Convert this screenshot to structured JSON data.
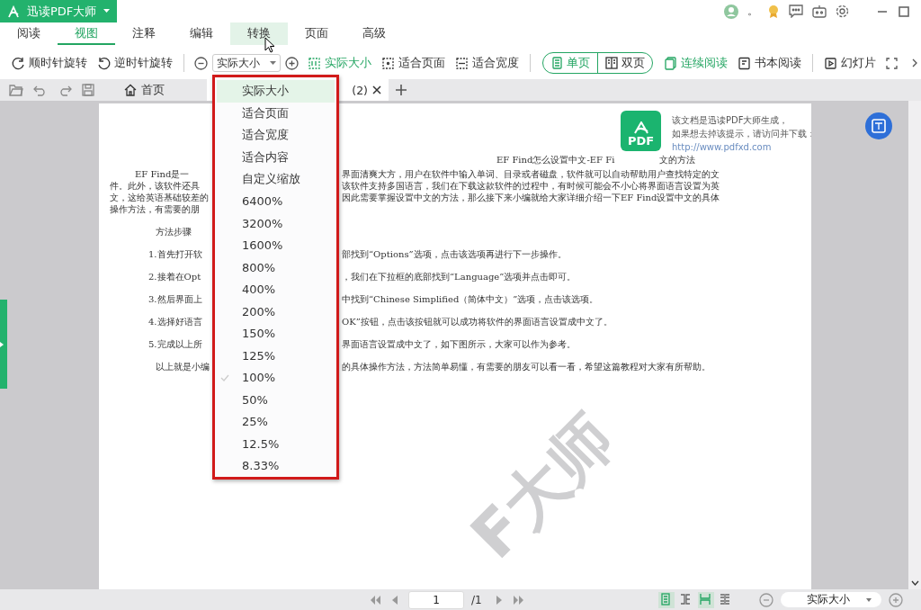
{
  "app": {
    "title": "迅读PDF大师",
    "status_mark": "。"
  },
  "menu_tabs": [
    {
      "label": "阅读",
      "selected": false,
      "hovered": false
    },
    {
      "label": "视图",
      "selected": true,
      "hovered": false
    },
    {
      "label": "注释",
      "selected": false,
      "hovered": false
    },
    {
      "label": "编辑",
      "selected": false,
      "hovered": false
    },
    {
      "label": "转换",
      "selected": false,
      "hovered": true
    },
    {
      "label": "页面",
      "selected": false,
      "hovered": false
    },
    {
      "label": "高级",
      "selected": false,
      "hovered": false
    }
  ],
  "toolbar": [
    {
      "kind": "button",
      "label": "顺时针旋转",
      "active": false
    },
    {
      "kind": "button",
      "label": "逆时针旋转",
      "active": false
    },
    {
      "kind": "divider"
    },
    {
      "kind": "icon"
    },
    {
      "kind": "combo",
      "value": "实际大小"
    },
    {
      "kind": "icon"
    },
    {
      "kind": "button",
      "label": "实际大小",
      "active": true
    },
    {
      "kind": "button",
      "label": "适合页面",
      "active": false
    },
    {
      "kind": "button",
      "label": "适合宽度",
      "active": false
    },
    {
      "kind": "divider"
    },
    {
      "kind": "segment",
      "options": [
        {
          "label": "单页",
          "selected": true
        },
        {
          "label": "双页",
          "selected": false
        }
      ]
    },
    {
      "kind": "button",
      "label": "连续阅读",
      "active": true
    },
    {
      "kind": "button",
      "label": "书本阅读",
      "active": false
    },
    {
      "kind": "divider"
    },
    {
      "kind": "button",
      "label": "幻灯片",
      "active": false
    },
    {
      "kind": "icon"
    },
    {
      "kind": "more"
    }
  ],
  "doc_tabs": [
    {
      "label": "首页",
      "selected": false
    },
    {
      "label": "(2)",
      "selected": true
    }
  ],
  "zoom_menu": [
    {
      "label": "实际大小",
      "selected": true,
      "checked": false
    },
    {
      "label": "适合页面",
      "selected": false,
      "checked": false
    },
    {
      "label": "适合宽度",
      "selected": false,
      "checked": false
    },
    {
      "label": "适合内容",
      "selected": false,
      "checked": false
    },
    {
      "label": "自定义缩放",
      "selected": false,
      "checked": false
    },
    {
      "label": "6400%",
      "selected": false,
      "checked": false
    },
    {
      "label": "3200%",
      "selected": false,
      "checked": false
    },
    {
      "label": "1600%",
      "selected": false,
      "checked": false
    },
    {
      "label": "800%",
      "selected": false,
      "checked": false
    },
    {
      "label": "400%",
      "selected": false,
      "checked": false
    },
    {
      "label": "200%",
      "selected": false,
      "checked": false
    },
    {
      "label": "150%",
      "selected": false,
      "checked": false
    },
    {
      "label": "125%",
      "selected": false,
      "checked": false
    },
    {
      "label": "100%",
      "selected": false,
      "checked": true
    },
    {
      "label": "50%",
      "selected": false,
      "checked": false
    },
    {
      "label": "25%",
      "selected": false,
      "checked": false
    },
    {
      "label": "12.5%",
      "selected": false,
      "checked": false
    },
    {
      "label": "8.33%",
      "selected": false,
      "checked": false
    }
  ],
  "document": {
    "title_parts": [
      "EF Find怎么设置中文-EF Fi",
      "文的方法"
    ],
    "paragraph_lines": [
      {
        "left": "EF Find是一",
        "right": "界面清爽大方，用户在软件中输入单词、目录或者磁盘，软件就可以自动帮助用户查找特定的文"
      },
      {
        "left": "件。此外，该软件还具",
        "right": "该软件支持多国语言，我们在下载这款软件的过程中，有时候可能会不小心将界面语言设置为英"
      },
      {
        "left": "文，这给英语基础较差的",
        "right": "因此需要掌握设置中文的方法，那么接下来小编就给大家详细介绍一下EF Find设置中文的具体"
      },
      {
        "left": "操作方法，有需要的朋"
      }
    ],
    "heading": "方法步骤",
    "steps": [
      {
        "left": "1.首先打开软",
        "right": "部找到“Options”选项，点击该选项再进行下一步操作。"
      },
      {
        "left": "2.接着在Opt",
        "right": "，我们在下拉框的底部找到“Language”选项并点击即可。"
      },
      {
        "left": "3.然后界面上",
        "right": "中找到“Chinese Simplified（简体中文）”选项，点击该选项。"
      },
      {
        "left": "4.选择好语言",
        "right": "OK”按钮，点击该按钮就可以成功将软件的界面语言设置成中文了。"
      },
      {
        "left": "5.完成以上所",
        "right": "界面语言设置成中文了，如下图所示，大家可以作为参考。"
      },
      {
        "left": "以上就是小编",
        "right": "的具体操作方法，方法简单易懂，有需要的朋友可以看一看，希望这篇教程对大家有所帮助。"
      }
    ],
    "notice": {
      "logo": "PDF",
      "lines": [
        "该文档是迅读PDF大师生成，",
        "如果想去掉该提示，请访问并下载："
      ],
      "link": "http://www.pdfxd.com"
    },
    "watermark": "F大师"
  },
  "status_bar": {
    "page": "1",
    "total": "/1",
    "views": [
      {
        "selected": true
      },
      {
        "selected": false
      },
      {
        "selected": true
      },
      {
        "selected": false
      }
    ],
    "zoom": "实际大小"
  }
}
